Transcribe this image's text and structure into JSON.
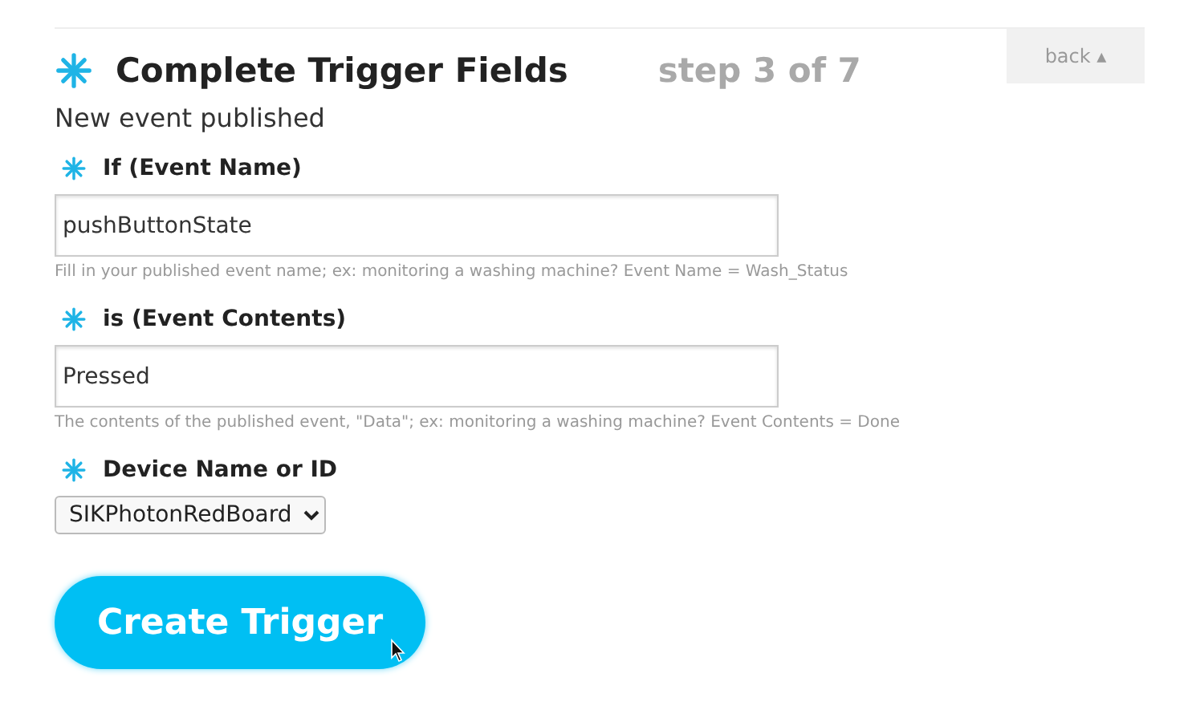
{
  "header": {
    "title": "Complete Trigger Fields",
    "step": "step 3 of 7",
    "back_button": "back ▴",
    "subtitle": "New event published"
  },
  "fields": [
    {
      "kind": "text",
      "label": "If (Event Name)",
      "value": "pushButtonState",
      "hint": "Fill in your published event name; ex: monitoring a washing machine? Event Name = Wash_Status"
    },
    {
      "kind": "text",
      "label": "is (Event Contents)",
      "value": "Pressed",
      "hint": "The contents of the published event, \"Data\"; ex: monitoring a washing machine? Event Contents = Done"
    },
    {
      "kind": "select",
      "label": "Device Name or ID",
      "value": "SIKPhotonRedBoard"
    }
  ],
  "submit_button": "Create Trigger"
}
